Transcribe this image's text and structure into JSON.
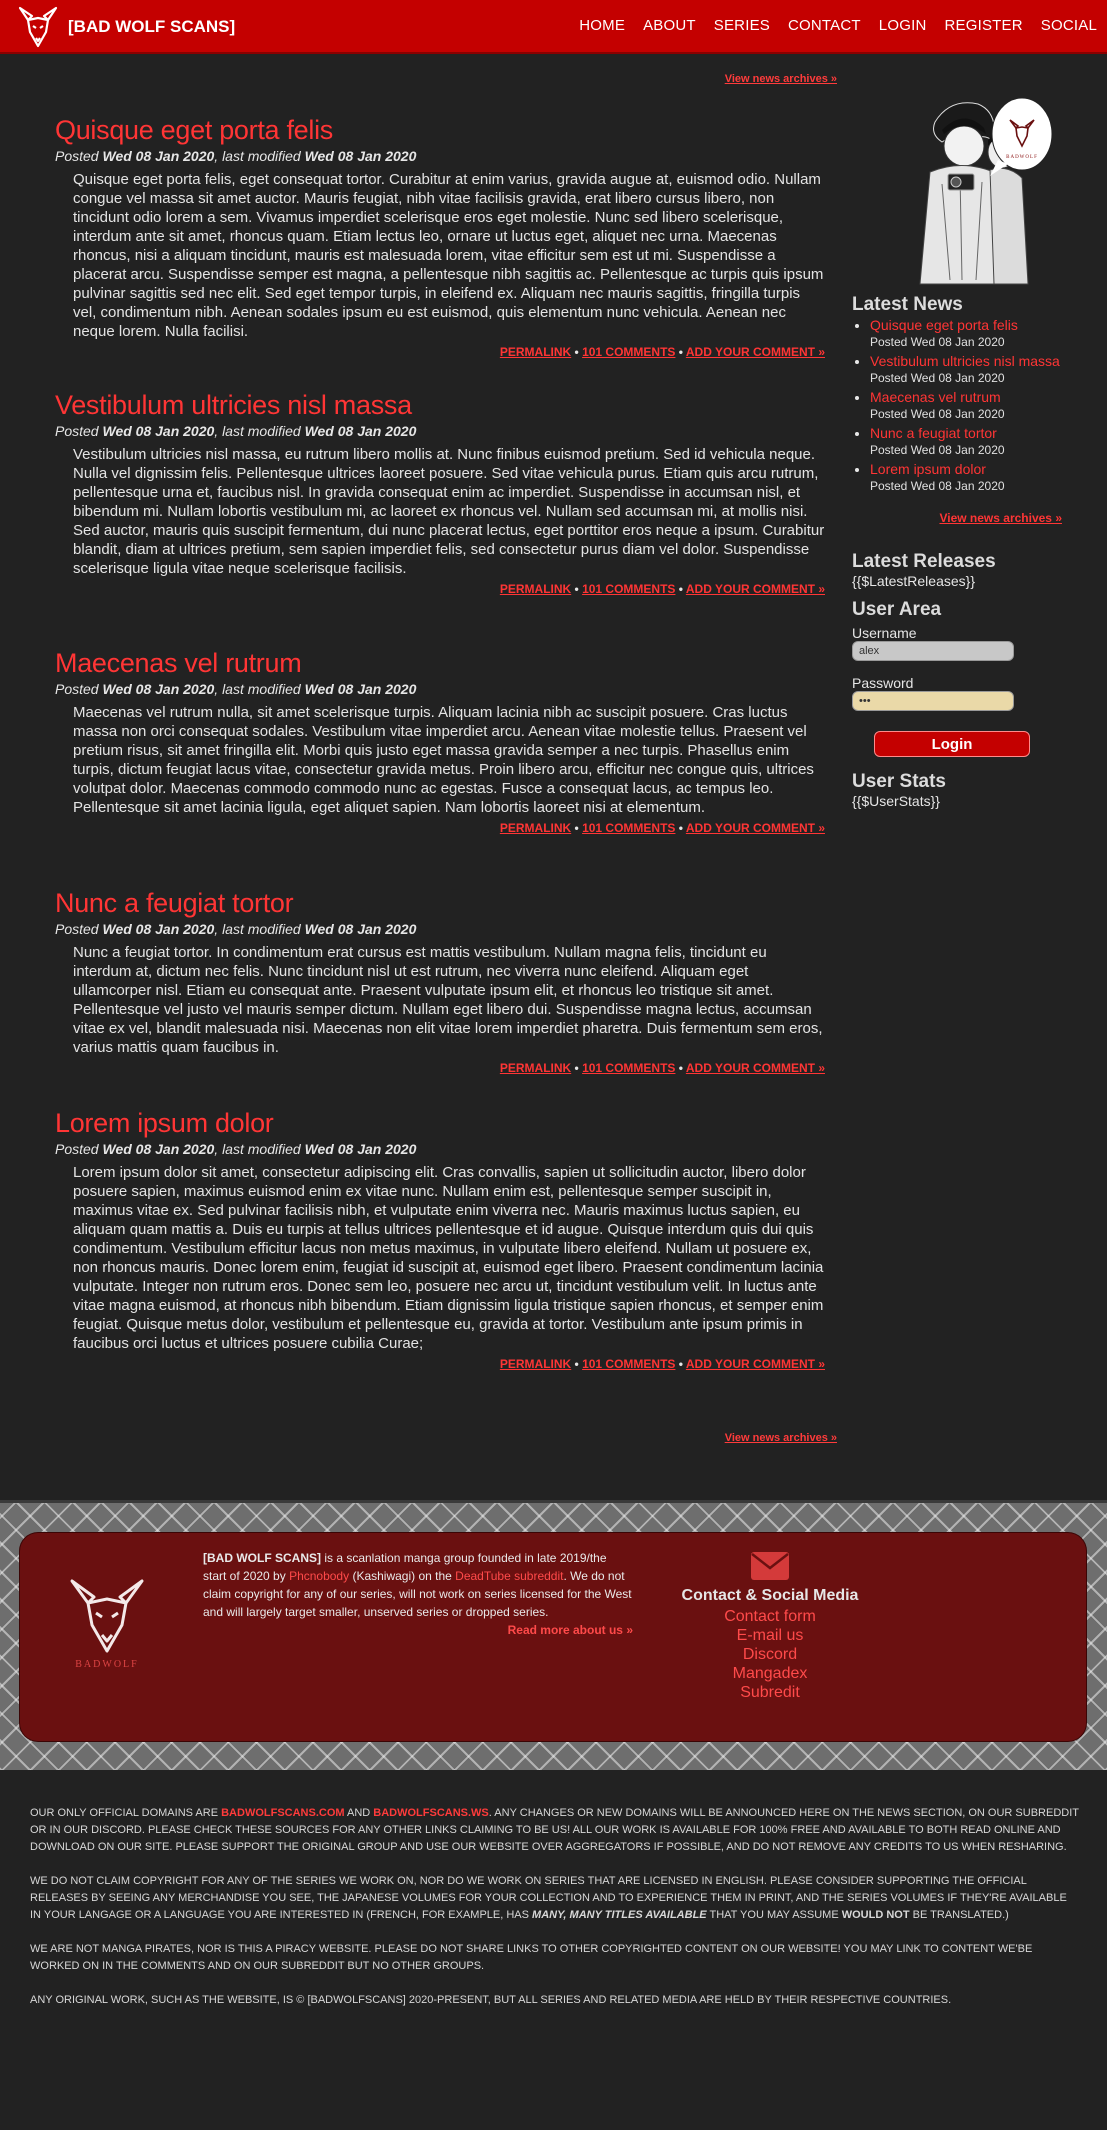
{
  "nav": {
    "brand": "[BAD WOLF SCANS]",
    "links": [
      "HOME",
      "ABOUT",
      "SERIES",
      "CONTACT",
      "LOGIN",
      "REGISTER",
      "SOCIAL"
    ]
  },
  "main": {
    "archives_label": "View news archives »",
    "posts": [
      {
        "title": "Quisque eget porta felis",
        "posted_label": "Posted",
        "posted_date": "Wed 08 Jan 2020",
        "modified_label": ", last modified",
        "modified_date": "Wed 08 Jan 2020",
        "body": "Quisque eget porta felis, eget consequat tortor. Curabitur at enim varius, gravida augue at, euismod odio. Nullam congue vel massa sit amet auctor. Mauris feugiat, nibh vitae facilisis gravida, erat libero cursus libero, non tincidunt odio lorem a sem. Vivamus imperdiet scelerisque eros eget molestie. Nunc sed libero scelerisque, interdum ante sit amet, rhoncus quam. Etiam lectus leo, ornare ut luctus eget, aliquet nec urna. Maecenas rhoncus, nisi a aliquam tincidunt, mauris est malesuada lorem, vitae efficitur sem est ut mi. Suspendisse a placerat arcu. Suspendisse semper est magna, a pellentesque nibh sagittis ac. Pellentesque ac turpis quis ipsum pulvinar sagittis sed nec elit. Sed eget tempor turpis, in eleifend ex. Aliquam nec mauris sagittis, fringilla turpis vel, condimentum nibh. Aenean sodales ipsum eu est euismod, quis elementum nunc vehicula. Aenean nec neque lorem. Nulla facilisi.",
        "permalink": "PERMALINK",
        "comments": "101 COMMENTS",
        "add_comment": "ADD YOUR COMMENT »"
      },
      {
        "title": "Vestibulum ultricies nisl massa",
        "posted_label": "Posted",
        "posted_date": "Wed 08 Jan 2020",
        "modified_label": ", last modified",
        "modified_date": "Wed 08 Jan 2020",
        "body": "Vestibulum ultricies nisl massa, eu rutrum libero mollis at. Nunc finibus euismod pretium. Sed id vehicula neque. Nulla vel dignissim felis. Pellentesque ultrices laoreet posuere. Sed vitae vehicula purus. Etiam quis arcu rutrum, pellentesque urna et, faucibus nisl. In gravida consequat enim ac imperdiet. Suspendisse in accumsan nisl, et bibendum mi. Nullam lobortis vestibulum mi, ac laoreet ex rhoncus vel. Nullam sed accumsan mi, at mollis nisi. Sed auctor, mauris quis suscipit fermentum, dui nunc placerat lectus, eget porttitor eros neque a ipsum. Curabitur blandit, diam at ultrices pretium, sem sapien imperdiet felis, sed consectetur purus diam vel dolor. Suspendisse scelerisque ligula vitae neque scelerisque facilisis.",
        "permalink": "PERMALINK",
        "comments": "101 COMMENTS",
        "add_comment": "ADD YOUR COMMENT »"
      },
      {
        "title": "Maecenas vel rutrum",
        "posted_label": "Posted",
        "posted_date": "Wed 08 Jan 2020",
        "modified_label": ", last modified",
        "modified_date": "Wed 08 Jan 2020",
        "body": "Maecenas vel rutrum nulla, sit amet scelerisque turpis. Aliquam lacinia nibh ac suscipit posuere. Cras luctus massa non orci consequat sodales. Vestibulum vitae imperdiet arcu. Aenean vitae molestie tellus. Praesent vel pretium risus, sit amet fringilla elit. Morbi quis justo eget massa gravida semper a nec turpis. Phasellus enim turpis, dictum feugiat lacus vitae, consectetur gravida metus. Proin libero arcu, efficitur nec congue quis, ultrices volutpat dolor. Maecenas commodo commodo nunc ac egestas. Fusce a consequat lacus, ac tempus leo. Pellentesque sit amet lacinia ligula, eget aliquet sapien. Nam lobortis laoreet nisi at elementum.",
        "permalink": "PERMALINK",
        "comments": "101 COMMENTS",
        "add_comment": "ADD YOUR COMMENT »"
      },
      {
        "title": "Nunc a feugiat tortor",
        "posted_label": "Posted",
        "posted_date": "Wed 08 Jan 2020",
        "modified_label": ", last modified",
        "modified_date": "Wed 08 Jan 2020",
        "body": "Nunc a feugiat tortor. In condimentum erat cursus est mattis vestibulum. Nullam magna felis, tincidunt eu interdum at, dictum nec felis. Nunc tincidunt nisl ut est rutrum, nec viverra nunc eleifend. Aliquam eget ullamcorper nisl. Etiam eu consequat ante. Praesent vulputate ipsum elit, et rhoncus leo tristique sit amet. Pellentesque vel justo vel mauris semper dictum. Nullam eget libero dui. Suspendisse magna lectus, accumsan vitae ex vel, blandit malesuada nisi. Maecenas non elit vitae lorem imperdiet pharetra. Duis fermentum sem eros, varius mattis quam faucibus in.",
        "permalink": "PERMALINK",
        "comments": "101 COMMENTS",
        "add_comment": "ADD YOUR COMMENT »"
      },
      {
        "title": "Lorem ipsum dolor",
        "posted_label": "Posted",
        "posted_date": "Wed 08 Jan 2020",
        "modified_label": ", last modified",
        "modified_date": "Wed 08 Jan 2020",
        "body": "Lorem ipsum dolor sit amet, consectetur adipiscing elit. Cras convallis, sapien ut sollicitudin auctor, libero dolor posuere sapien, maximus euismod enim ex vitae nunc. Nullam enim est, pellentesque semper suscipit in, maximus vitae ex. Sed pulvinar facilisis nibh, et vulputate enim viverra nec. Mauris maximus luctus sapien, eu aliquam quam mattis a. Duis eu turpis at tellus ultrices pellentesque et id augue. Quisque interdum quis dui quis condimentum. Vestibulum efficitur lacus non metus maximus, in vulputate libero eleifend. Nullam ut posuere ex, non rhoncus mauris. Donec lorem enim, feugiat id suscipit at, euismod eget libero. Praesent condimentum lacinia vulputate. Integer non rutrum eros. Donec sem leo, posuere nec arcu ut, tincidunt vestibulum velit. In luctus ante vitae magna euismod, at rhoncus nibh bibendum. Etiam dignissim ligula tristique sapien rhoncus, et semper enim feugiat. Quisque metus dolor, vestibulum et pellentesque eu, gravida at tortor. Vestibulum ante ipsum primis in faucibus orci luctus et ultrices posuere cubilia Curae;",
        "permalink": "PERMALINK",
        "comments": "101 COMMENTS",
        "add_comment": "ADD YOUR COMMENT »"
      }
    ]
  },
  "sidebar": {
    "latest_news_title": "Latest News",
    "news": [
      {
        "title": "Quisque eget porta felis",
        "date": "Posted Wed 08 Jan 2020"
      },
      {
        "title": "Vestibulum ultricies nisl massa",
        "date": "Posted Wed 08 Jan 2020"
      },
      {
        "title": "Maecenas vel rutrum",
        "date": "Posted Wed 08 Jan 2020"
      },
      {
        "title": "Nunc a feugiat tortor",
        "date": "Posted Wed 08 Jan 2020"
      },
      {
        "title": "Lorem ipsum dolor",
        "date": "Posted Wed 08 Jan 2020"
      }
    ],
    "archives_label": "View news archives »",
    "latest_releases_title": "Latest Releases",
    "latest_releases_placeholder": "{{$LatestReleases}}",
    "user_area_title": "User Area",
    "username_label": "Username",
    "username_value": "alex",
    "password_label": "Password",
    "password_value": "•••",
    "login_label": "Login",
    "user_stats_title": "User Stats",
    "user_stats_placeholder": "{{$UserStats}}",
    "speech_logo_text": "BADWOLF"
  },
  "footer": {
    "logo_text": "BADWOLF",
    "about": {
      "brand": "[BAD WOLF SCANS]",
      "text1": " is a scanlation manga group founded in late 2019/the start of 2020 by ",
      "founder": "Phcnobody",
      "text2": " (Kashiwagi) on the ",
      "subreddit_link": "DeadTube subreddit",
      "text3": ". We do not claim copyright for any of our series, will not work on series licensed for the West and will largely target smaller, unserved series or dropped series.",
      "read_more": "Read more about us »"
    },
    "contact": {
      "title": "Contact & Social Media",
      "links": [
        "Contact form",
        "E-mail us",
        "Discord",
        "Mangadex",
        "Subredit"
      ]
    }
  },
  "legal": {
    "p1_a": "OUR ONLY OFFICIAL DOMAINS ARE ",
    "domain1": "BADWOLFSCANS.COM",
    "p1_and": " AND ",
    "domain2": "BADWOLFSCANS.WS",
    "p1_b": ". ANY CHANGES OR NEW DOMAINS WILL BE ANNOUNCED HERE ON THE NEWS SECTION, ON OUR SUBREDDIT OR IN OUR DISCORD. PLEASE CHECK THESE SOURCES FOR ANY OTHER LINKS CLAIMING TO BE US! ALL OUR WORK IS AVAILABLE FOR 100% FREE AND AVAILABLE TO BOTH READ ONLINE AND DOWNLOAD ON OUR SITE. PLEASE SUPPORT THE ORIGINAL GROUP AND USE OUR WEBSITE OVER AGGREGATORS IF POSSIBLE, AND DO NOT REMOVE ANY CREDITS TO US WHEN RESHARING.",
    "p2_a": "WE DO NOT CLAIM COPYRIGHT FOR ANY OF THE SERIES WE WORK ON, NOR DO WE WORK ON SERIES THAT ARE LICENSED IN ENGLISH. PLEASE CONSIDER SUPPORTING THE OFFICIAL RELEASES BY SEEING ANY MERCHANDISE YOU SEE, THE JAPANESE VOLUMES FOR YOUR COLLECTION AND TO EXPERIENCE THEM IN PRINT, AND THE SERIES VOLUMES IF THEY'RE AVAILABLE IN YOUR LANGAGE OR A LANGUAGE YOU ARE INTERESTED IN (FRENCH, FOR EXAMPLE, HAS ",
    "p2_em": "MANY, MANY TITLES AVAILABLE",
    "p2_b": " THAT YOU MAY ASSUME ",
    "p2_strong": "WOULD NOT",
    "p2_c": " BE TRANSLATED.)",
    "p3": "WE ARE NOT MANGA PIRATES, NOR IS THIS A PIRACY WEBSITE. PLEASE DO NOT SHARE LINKS TO OTHER COPYRIGHTED CONTENT ON OUR WEBSITE! YOU MAY LINK TO CONTENT WE'BE WORKED ON IN THE COMMENTS AND ON OUR SUBREDDIT BUT NO OTHER GROUPS.",
    "p4": "ANY ORIGINAL WORK, SUCH AS THE WEBSITE, IS © [BADWOLFSCANS] 2020-PRESENT, BUT ALL SERIES AND RELATED MEDIA ARE HELD BY THEIR RESPECTIVE COUNTRIES."
  }
}
